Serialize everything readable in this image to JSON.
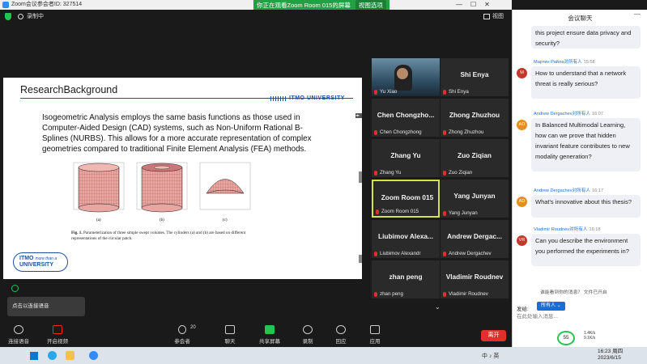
{
  "window": {
    "title": "Zoom会议参会者ID: 327514"
  },
  "viewing_banner": {
    "text": "你正在观看Zoom Room 015的屏幕",
    "options": "视图选项"
  },
  "topbar": {
    "recording_label": "录制中",
    "view_label": "视图"
  },
  "slide": {
    "title": "ResearchBackground",
    "logo_text": "ITMO UNIVERSITY",
    "body": "Isogeometric Analysis employs the same basis functions as those used in Computer-Aided Design (CAD) systems, such as Non-Uniform Rational B-Splines (NURBS). This allows for a more accurate representation of complex geometries compared to traditional Finite Element Analysis (FEA) methods.",
    "fig_labels": [
      "(a)",
      "(b)",
      "(c)"
    ],
    "fig_caption_bold": "Fig. 1.",
    "fig_caption": "Parameterization of three simple swept volumes. The cylinders (a) and (b) are based on different representations of the circular patch.",
    "badge_top": "ITMO",
    "badge_script": "more than a",
    "badge_bottom": "UNIVERSITY"
  },
  "gallery": [
    {
      "big": "",
      "sub": "Yu Xiao",
      "video": true,
      "active": false
    },
    {
      "big": "Shi Enya",
      "sub": "Shi Enya",
      "video": false,
      "active": false
    },
    {
      "big": "Chen Chongzho...",
      "sub": "Chen Chongzhong",
      "video": false,
      "active": false
    },
    {
      "big": "Zhong Zhuzhou",
      "sub": "Zhong Zhuzhou",
      "video": false,
      "active": false
    },
    {
      "big": "Zhang Yu",
      "sub": "Zhang Yu",
      "video": false,
      "active": false
    },
    {
      "big": "Zuo Ziqian",
      "sub": "Zuo Ziqian",
      "video": false,
      "active": false
    },
    {
      "big": "Zoom Room 015",
      "sub": "Zoom Room 015",
      "video": false,
      "active": true
    },
    {
      "big": "Yang Junyan",
      "sub": "Yang Junyan",
      "video": false,
      "active": false
    },
    {
      "big": "Liubimov Alexa...",
      "sub": "Liubimov Alexandr",
      "video": false,
      "active": false
    },
    {
      "big": "Andrew Dergac...",
      "sub": "Andrew Dergachev",
      "video": false,
      "active": false
    },
    {
      "big": "zhan peng",
      "sub": "zhan peng",
      "video": false,
      "active": false
    },
    {
      "big": "Vladimir Roudnev",
      "sub": "Vladimir Roudnev",
      "video": false,
      "active": false
    }
  ],
  "toolbar": {
    "audio": "连接语音",
    "video": "开启视频",
    "participants": "参会者",
    "participants_count": "20",
    "chat": "聊天",
    "share": "共享屏幕",
    "record": "录制",
    "reactions": "回应",
    "apps": "应用",
    "leave": "离开",
    "popup": "点击以连接语音"
  },
  "chat": {
    "title": "会议聊天",
    "messages": [
      {
        "avatar": "",
        "avatar_color": "",
        "sender": "",
        "time": "",
        "text": "this project ensure data privacy and security?"
      },
      {
        "avatar": "M",
        "avatar_color": "#c0392b",
        "sender": "Мартин Райла对所有人",
        "time": "15:58",
        "text": "How to understand that a network threat is really serious?"
      },
      {
        "avatar": "AD",
        "avatar_color": "#e58e26",
        "sender": "Andrew Dergachev对所有人",
        "time": "16:07",
        "text": "In Balanced Multimodal Learning, how can we prove that hidden invariant feature contributes to new modality generation?"
      },
      {
        "avatar": "AD",
        "avatar_color": "#e58e26",
        "sender": "Andrew Dergachev对所有人",
        "time": "16:17",
        "text": "What's innovative about this thesis?"
      },
      {
        "avatar": "VR",
        "avatar_color": "#c0392b",
        "sender": "Vladimir Roudnev对所有人",
        "time": "16:18",
        "text": "Can you describe the environment you performed the experiments in?"
      }
    ],
    "hint": "谁能看到你的消息？ 文件已开启",
    "send_to_label": "发给:",
    "send_to_value": "所有人",
    "input_placeholder": "在此处输入消息...",
    "net_value": "55",
    "net_up": "1.4K/s",
    "net_down": "9.1K/s"
  },
  "taskbar": {
    "time": "16:23 周四",
    "date": "2023/6/15",
    "tray_text": "中 ♪ 英"
  }
}
